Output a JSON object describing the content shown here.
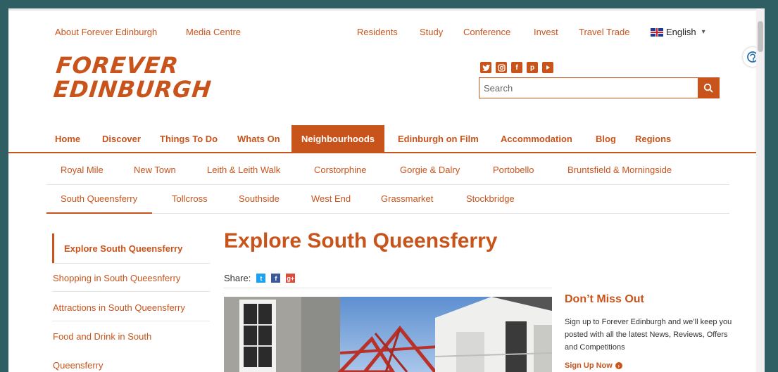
{
  "utility_left": [
    "About Forever Edinburgh",
    "Media Centre"
  ],
  "utility_right": [
    "Residents",
    "Study",
    "Conference",
    "Invest",
    "Travel Trade"
  ],
  "language": "English",
  "logo": {
    "line1": "FOREVER",
    "line2": "EDINBURGH"
  },
  "social_icons": [
    "twitter-icon",
    "instagram-icon",
    "facebook-icon",
    "pinterest-icon",
    "youtube-icon"
  ],
  "search": {
    "placeholder": "Search"
  },
  "main_nav": [
    "Home",
    "Discover",
    "Things To Do",
    "Whats On",
    "Neighbourhoods",
    "Edinburgh on Film",
    "Accommodation",
    "Blog",
    "Regions"
  ],
  "main_nav_active": "Neighbourhoods",
  "sub_nav_row1": [
    "Royal Mile",
    "New Town",
    "Leith & Leith Walk",
    "Corstorphine",
    "Gorgie & Dalry",
    "Portobello",
    "Bruntsfield & Morningside"
  ],
  "sub_nav_row2": [
    "South Queensferry",
    "Tollcross",
    "Southside",
    "West End",
    "Grassmarket",
    "Stockbridge"
  ],
  "sidebar": [
    "Explore South Queensferry",
    "Shopping in South Queesnferry",
    "Attractions in South Queensferry",
    "Food and Drink in South",
    "Queensferry"
  ],
  "content": {
    "title": "Explore South Queensferry",
    "share_label": "Share:"
  },
  "promo": {
    "title": "Don’t Miss Out",
    "text": "Sign up to Forever Edinburgh and we’ll keep you posted with all the latest News, Reviews, Offers and Competitions",
    "link": "Sign Up Now"
  },
  "colors": {
    "accent": "#c8541c",
    "frame": "#2f5f63"
  }
}
